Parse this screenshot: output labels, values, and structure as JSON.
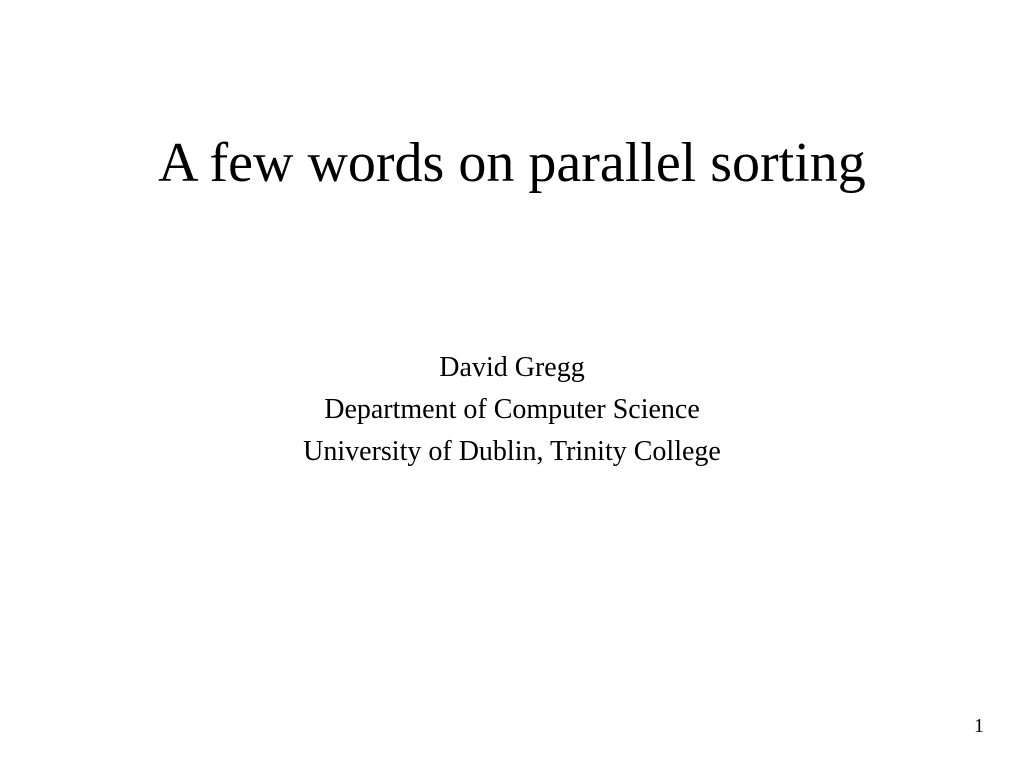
{
  "slide": {
    "title": "A few words on parallel sorting",
    "author": "David Gregg",
    "department": "Department of Computer Science",
    "institution": "University of Dublin, Trinity College",
    "page_number": "1"
  }
}
